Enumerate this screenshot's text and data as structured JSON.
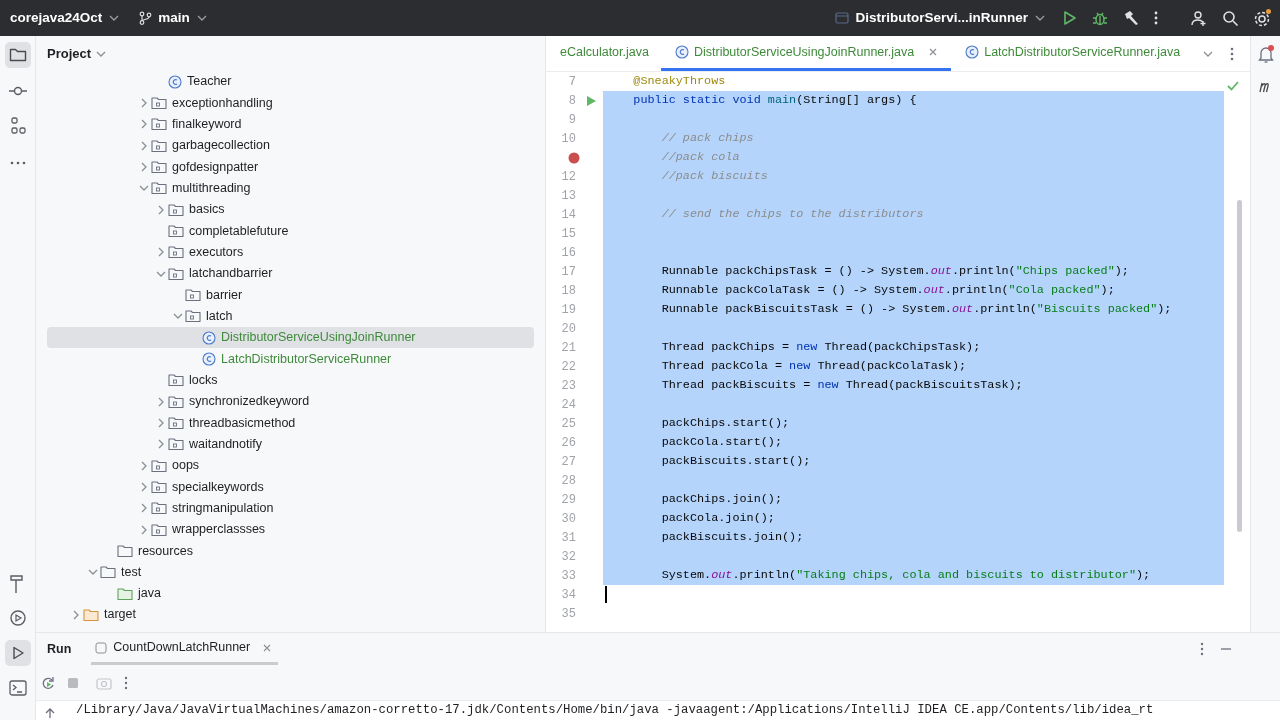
{
  "title_bar": {
    "project": "corejava24Oct",
    "branch": "main",
    "run_configuration": "DistributorServi...inRunner"
  },
  "project_panel": {
    "title": "Project",
    "tree": [
      {
        "children": [
          {
            "children": [
              {
                "children": [
                  {
                    "children": [
                      {
                        "children": [
                          {
                            "label": "Teacher",
                            "kind": "class",
                            "color": "#1e1f22",
                            "selected": false
                          }
                        ]
                      },
                      {
                        "label": "exceptionhandling",
                        "kind": "package",
                        "expanded": false,
                        "selected": false
                      },
                      {
                        "label": "finalkeyword",
                        "kind": "package",
                        "expanded": false,
                        "selected": false
                      },
                      {
                        "label": "garbagecollection",
                        "kind": "package",
                        "expanded": false,
                        "selected": false
                      },
                      {
                        "label": "gofdesignpatter",
                        "kind": "package",
                        "expanded": false,
                        "selected": false
                      },
                      {
                        "label": "multithreading",
                        "kind": "package",
                        "expanded": true,
                        "selected": false,
                        "children": [
                          {
                            "label": "basics",
                            "kind": "package",
                            "expanded": false,
                            "selected": false
                          },
                          {
                            "label": "completablefuture",
                            "kind": "package",
                            "selected": false
                          },
                          {
                            "label": "executors",
                            "kind": "package",
                            "expanded": false,
                            "selected": false
                          },
                          {
                            "label": "latchandbarrier",
                            "kind": "package",
                            "expanded": true,
                            "selected": false,
                            "children": [
                              {
                                "label": "barrier",
                                "kind": "package",
                                "selected": false
                              },
                              {
                                "label": "latch",
                                "kind": "package",
                                "expanded": true,
                                "selected": false,
                                "children": [
                                  {
                                    "label": "DistributorServiceUsingJoinRunner",
                                    "kind": "class",
                                    "color": "#3e8a3a",
                                    "selected": true
                                  },
                                  {
                                    "label": "LatchDistributorServiceRunner",
                                    "kind": "class",
                                    "color": "#3e8a3a",
                                    "selected": false
                                  }
                                ]
                              }
                            ]
                          },
                          {
                            "label": "locks",
                            "kind": "package",
                            "selected": false
                          },
                          {
                            "label": "synchronizedkeyword",
                            "kind": "package",
                            "expanded": false,
                            "selected": false
                          },
                          {
                            "label": "threadbasicmethod",
                            "kind": "package",
                            "expanded": false,
                            "selected": false
                          },
                          {
                            "label": "waitandnotify",
                            "kind": "package",
                            "expanded": false,
                            "selected": false
                          }
                        ]
                      },
                      {
                        "label": "oops",
                        "kind": "package",
                        "expanded": false,
                        "selected": false
                      },
                      {
                        "label": "specialkeywords",
                        "kind": "package",
                        "expanded": false,
                        "selected": false
                      },
                      {
                        "label": "stringmanipulation",
                        "kind": "package",
                        "expanded": false,
                        "selected": false
                      },
                      {
                        "label": "wrapperclassses",
                        "kind": "package",
                        "expanded": false,
                        "selected": false
                      }
                    ]
                  }
                ]
              },
              {
                "label": "resources",
                "kind": "folder",
                "selected": false
              }
            ]
          },
          {
            "label": "test",
            "kind": "folder",
            "expanded": true,
            "selected": false,
            "children": [
              {
                "label": "java",
                "kind": "test_source_folder",
                "selected": false
              }
            ]
          }
        ]
      },
      {
        "label": "target",
        "kind": "excluded_folder",
        "expanded": false,
        "selected": false
      }
    ]
  },
  "editor": {
    "tabs": [
      {
        "label": "eCalculator.java",
        "color": "#3e8a3a",
        "selected": false,
        "closable": false
      },
      {
        "label": "DistributorServiceUsingJoinRunner.java",
        "color": "#3e8a3a",
        "selected": true,
        "closable": true
      },
      {
        "label": "LatchDistributorServiceRunner.java",
        "color": "#3e8a3a",
        "selected": false,
        "closable": false
      }
    ],
    "lines": [
      {
        "n": "7",
        "tokens": [
          {
            "kind": "annotation",
            "text": "    @SneakyThrows"
          }
        ],
        "selected": false,
        "run_marker": false,
        "breakpoint": false,
        "caret": false
      },
      {
        "n": "8",
        "tokens": [
          {
            "kind": "keyword",
            "text": "    public static void "
          },
          {
            "kind": "method",
            "text": "main"
          },
          {
            "kind": "plain",
            "text": "(String[] args) {"
          }
        ],
        "selected": true,
        "run_marker": true,
        "breakpoint": false,
        "caret": false
      },
      {
        "n": "9",
        "selected": true,
        "run_marker": false,
        "breakpoint": false,
        "caret": false
      },
      {
        "n": "10",
        "tokens": [
          {
            "kind": "comment",
            "text": "        // pack chips"
          }
        ],
        "selected": true,
        "run_marker": false,
        "breakpoint": false,
        "caret": false
      },
      {
        "tokens": [
          {
            "kind": "comment",
            "text": "        //pack cola"
          }
        ],
        "selected": true,
        "run_marker": false,
        "breakpoint": true,
        "caret": false
      },
      {
        "n": "12",
        "tokens": [
          {
            "kind": "comment",
            "text": "        //pack biscuits"
          }
        ],
        "selected": true,
        "run_marker": false,
        "breakpoint": false,
        "caret": false
      },
      {
        "n": "13",
        "selected": true,
        "run_marker": false,
        "breakpoint": false,
        "caret": false
      },
      {
        "n": "14",
        "tokens": [
          {
            "kind": "comment",
            "text": "        // send the chips to the distributors"
          }
        ],
        "selected": true,
        "run_marker": false,
        "breakpoint": false,
        "caret": false
      },
      {
        "n": "15",
        "selected": true,
        "run_marker": false,
        "breakpoint": false,
        "caret": false
      },
      {
        "n": "16",
        "selected": true,
        "run_marker": false,
        "breakpoint": false,
        "caret": false
      },
      {
        "n": "17",
        "tokens": [
          {
            "kind": "plain",
            "text": "        Runnable packChipsTask = () -> System."
          },
          {
            "kind": "field",
            "text": "out"
          },
          {
            "kind": "plain",
            "text": ".println("
          },
          {
            "kind": "string",
            "text": "\"Chips packed\""
          },
          {
            "kind": "plain",
            "text": ");"
          }
        ],
        "selected": true,
        "run_marker": false,
        "breakpoint": false,
        "caret": false
      },
      {
        "n": "18",
        "tokens": [
          {
            "kind": "plain",
            "text": "        Runnable packColaTask = () -> System."
          },
          {
            "kind": "field",
            "text": "out"
          },
          {
            "kind": "plain",
            "text": ".println("
          },
          {
            "kind": "string",
            "text": "\"Cola packed\""
          },
          {
            "kind": "plain",
            "text": ");"
          }
        ],
        "selected": true,
        "run_marker": false,
        "breakpoint": false,
        "caret": false
      },
      {
        "n": "19",
        "tokens": [
          {
            "kind": "plain",
            "text": "        Runnable packBiscuitsTask = () -> System."
          },
          {
            "kind": "field",
            "text": "out"
          },
          {
            "kind": "plain",
            "text": ".println("
          },
          {
            "kind": "string",
            "text": "\"Biscuits packed\""
          },
          {
            "kind": "plain",
            "text": ");"
          }
        ],
        "selected": true,
        "run_marker": false,
        "breakpoint": false,
        "caret": false
      },
      {
        "n": "20",
        "selected": true,
        "run_marker": false,
        "breakpoint": false,
        "caret": false
      },
      {
        "n": "21",
        "tokens": [
          {
            "kind": "plain",
            "text": "        Thread packChips = "
          },
          {
            "kind": "keyword",
            "text": "new"
          },
          {
            "kind": "plain",
            "text": " Thread(packChipsTask);"
          }
        ],
        "selected": true,
        "run_marker": false,
        "breakpoint": false,
        "caret": false
      },
      {
        "n": "22",
        "tokens": [
          {
            "kind": "plain",
            "text": "        Thread packCola = "
          },
          {
            "kind": "keyword",
            "text": "new"
          },
          {
            "kind": "plain",
            "text": " Thread(packColaTask);"
          }
        ],
        "selected": true,
        "run_marker": false,
        "breakpoint": false,
        "caret": false
      },
      {
        "n": "23",
        "tokens": [
          {
            "kind": "plain",
            "text": "        Thread packBiscuits = "
          },
          {
            "kind": "keyword",
            "text": "new"
          },
          {
            "kind": "plain",
            "text": " Thread(packBiscuitsTask);"
          }
        ],
        "selected": true,
        "run_marker": false,
        "breakpoint": false,
        "caret": false
      },
      {
        "n": "24",
        "selected": true,
        "run_marker": false,
        "breakpoint": false,
        "caret": false
      },
      {
        "n": "25",
        "tokens": [
          {
            "kind": "plain",
            "text": "        packChips.start();"
          }
        ],
        "selected": true,
        "run_marker": false,
        "breakpoint": false,
        "caret": false
      },
      {
        "n": "26",
        "tokens": [
          {
            "kind": "plain",
            "text": "        packCola.start();"
          }
        ],
        "selected": true,
        "run_marker": false,
        "breakpoint": false,
        "caret": false
      },
      {
        "n": "27",
        "tokens": [
          {
            "kind": "plain",
            "text": "        packBiscuits.start();"
          }
        ],
        "selected": true,
        "run_marker": false,
        "breakpoint": false,
        "caret": false
      },
      {
        "n": "28",
        "selected": true,
        "run_marker": false,
        "breakpoint": false,
        "caret": false
      },
      {
        "n": "29",
        "tokens": [
          {
            "kind": "plain",
            "text": "        packChips.join();"
          }
        ],
        "selected": true,
        "run_marker": false,
        "breakpoint": false,
        "caret": false
      },
      {
        "n": "30",
        "tokens": [
          {
            "kind": "plain",
            "text": "        packCola.join();"
          }
        ],
        "selected": true,
        "run_marker": false,
        "breakpoint": false,
        "caret": false
      },
      {
        "n": "31",
        "tokens": [
          {
            "kind": "plain",
            "text": "        packBiscuits.join();"
          }
        ],
        "selected": true,
        "run_marker": false,
        "breakpoint": false,
        "caret": false
      },
      {
        "n": "32",
        "selected": true,
        "run_marker": false,
        "breakpoint": false,
        "caret": false
      },
      {
        "n": "33",
        "tokens": [
          {
            "kind": "plain",
            "text": "        System."
          },
          {
            "kind": "field",
            "text": "out"
          },
          {
            "kind": "plain",
            "text": ".println("
          },
          {
            "kind": "string",
            "text": "\"Taking chips, cola and biscuits to distributor\""
          },
          {
            "kind": "plain",
            "text": ");"
          }
        ],
        "selected": true,
        "run_marker": false,
        "breakpoint": false,
        "caret": false
      },
      {
        "n": "34",
        "selected": false,
        "run_marker": false,
        "breakpoint": false,
        "caret": true
      },
      {
        "n": "35",
        "selected": false,
        "run_marker": false,
        "breakpoint": false,
        "caret": false
      }
    ]
  },
  "run_panel": {
    "title": "Run",
    "tabs": [
      {
        "label": "CountDownLatchRunner",
        "selected": true
      }
    ],
    "output": [
      "/Library/Java/JavaVirtualMachines/amazon-corretto-17.jdk/Contents/Home/bin/java -javaagent:/Applications/IntelliJ IDEA CE.app/Contents/lib/idea_rt"
    ]
  }
}
